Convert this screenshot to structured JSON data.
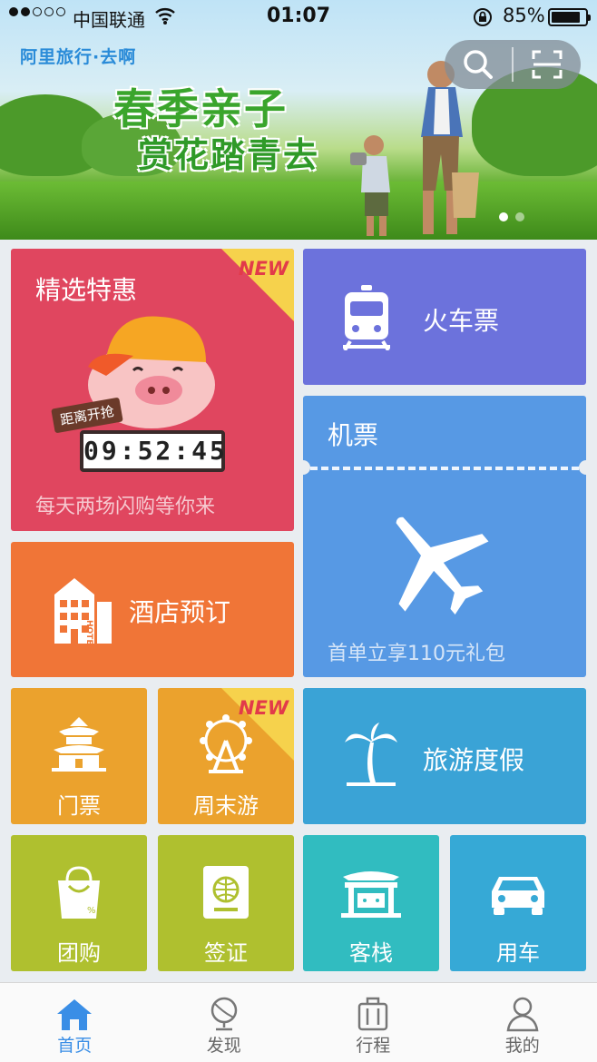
{
  "status": {
    "carrier": "中国联通",
    "time": "01:07",
    "battery": "85%",
    "battery_level": 0.85
  },
  "banner": {
    "brand": "阿里旅行·去啊",
    "headline1": "春季亲子",
    "headline2": "赏花踏青去",
    "page": 1,
    "pages": 2
  },
  "tiles": {
    "deals": {
      "title": "精选特惠",
      "badge": "NEW",
      "tag": "距离开抢",
      "countdown": "09:52:45",
      "subtitle": "每天两场闪购等你来",
      "color": "#e0465f"
    },
    "train": {
      "label": "火车票",
      "color": "#6c72dc"
    },
    "flight": {
      "label": "机票",
      "promo": "首单立享110元礼包",
      "color": "#5799e4"
    },
    "hotel": {
      "label": "酒店预订",
      "sign": "HOTEL",
      "color": "#f07537"
    },
    "tickets": {
      "label": "门票",
      "color": "#eba22d"
    },
    "weekend": {
      "label": "周末游",
      "badge": "NEW",
      "color": "#eba22d"
    },
    "vacation": {
      "label": "旅游度假",
      "color": "#3aa3d6"
    },
    "groupbuy": {
      "label": "团购",
      "color": "#afc02f"
    },
    "visa": {
      "label": "签证",
      "color": "#afc02f"
    },
    "inn": {
      "label": "客栈",
      "color": "#31bcc0"
    },
    "car": {
      "label": "用车",
      "color": "#36a9d6"
    }
  },
  "nav": [
    {
      "label": "首页",
      "icon": "home-icon",
      "active": true
    },
    {
      "label": "发现",
      "icon": "globe-icon",
      "active": false
    },
    {
      "label": "行程",
      "icon": "luggage-icon",
      "active": false
    },
    {
      "label": "我的",
      "icon": "user-icon",
      "active": false
    }
  ]
}
